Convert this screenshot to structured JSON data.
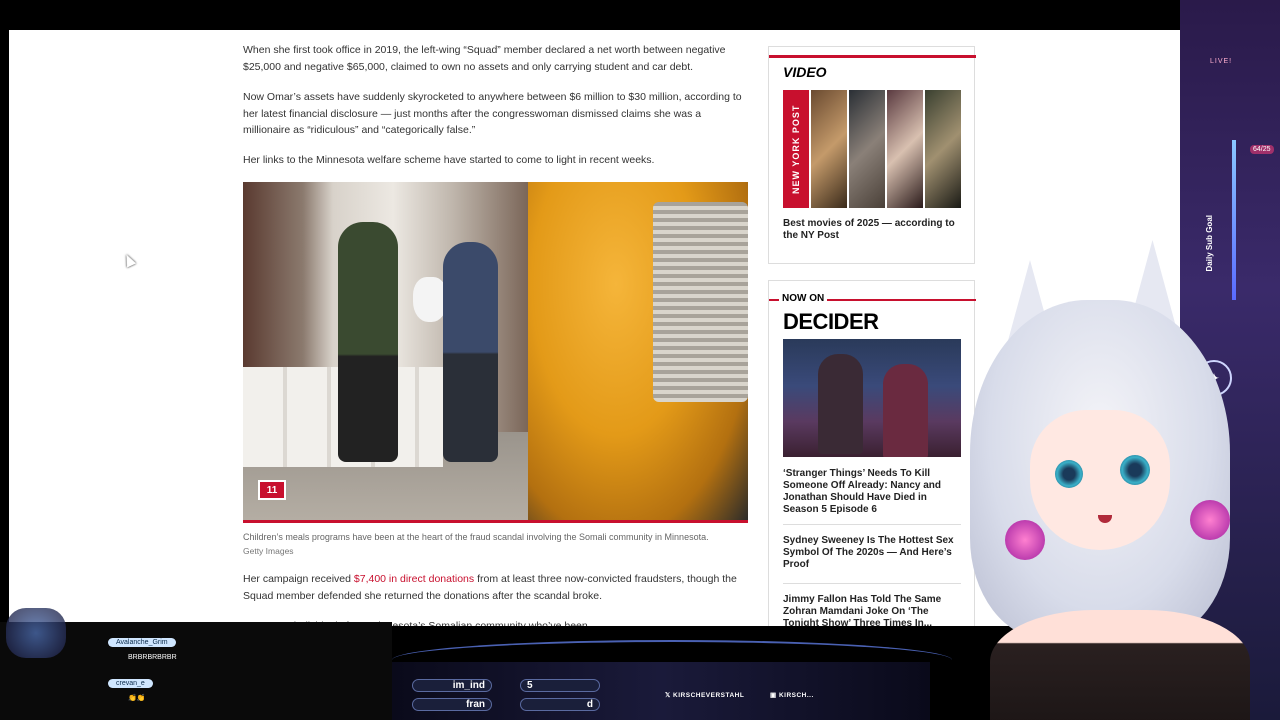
{
  "article": {
    "p1": "When she first took office in 2019, the left-wing “Squad” member declared a net worth between negative $25,000 and negative $65,000, claimed to own no assets and only carrying student and car debt.",
    "p2": "Now Omar’s assets have suddenly skyrocketed to anywhere between $6 million to $30 million, according to her latest financial disclosure — just months after the congresswoman dismissed claims she was a millionaire as “ridiculous” and “categorically false.”",
    "p3": "Her links to the Minnesota welfare scheme have started to come to light in recent weeks.",
    "gallery_count": "11",
    "photo_icon": "gallery-icon",
    "caption": "Children’s meals programs have been at the heart of the fraud scandal involving the Somali community in Minnesota.",
    "credit": "Getty Images",
    "p4_before": "Her campaign received ",
    "p4_link": "$7,400 in direct donations",
    "p4_after": " from at least three now-convicted fraudsters, though the Squad member defended she returned the donations after the scandal broke.",
    "p5_partial": "...east two individuals from Minnesota’s Somalian community who’ve been"
  },
  "sidebar": {
    "video_label": "VIDEO",
    "video_brand": "NEW YORK POST",
    "video_caption": "Best movies of 2025 — according to the NY Post",
    "now_on_label": "NOW ON",
    "decider_label": "DECIDER",
    "stories": [
      {
        "title": "‘Stranger Things’ Needs To Kill Someone Off Already: Nancy and Jonathan Should Have Died in Season 5 Episode 6"
      },
      {
        "title": "Sydney Sweeney Is The Hottest Sex Symbol Of The 2020s — And Here’s Proof"
      },
      {
        "title": "Jimmy Fallon Has Told The Same Zohran Mamdani Joke On ‘The Tonight Show’ Three Times In..."
      }
    ]
  },
  "overlay": {
    "live_label": "LIVE!",
    "sub_goal_label": "Daily Sub Goal",
    "sub_goal_count": "64/25",
    "chat": [
      {
        "user": "Avalanche_Grim",
        "message": "BRBRBRBRBR"
      },
      {
        "user": "crevan_e",
        "message": "👏👏"
      }
    ],
    "bar_items": [
      {
        "name": "im_ind",
        "value": "5"
      },
      {
        "name": "fran",
        "value": "d"
      }
    ],
    "socials": [
      "KIRSCHEVERSTAHL",
      "KIRSCH..."
    ]
  },
  "colors": {
    "accent": "#c8102e",
    "text": "#333333"
  }
}
